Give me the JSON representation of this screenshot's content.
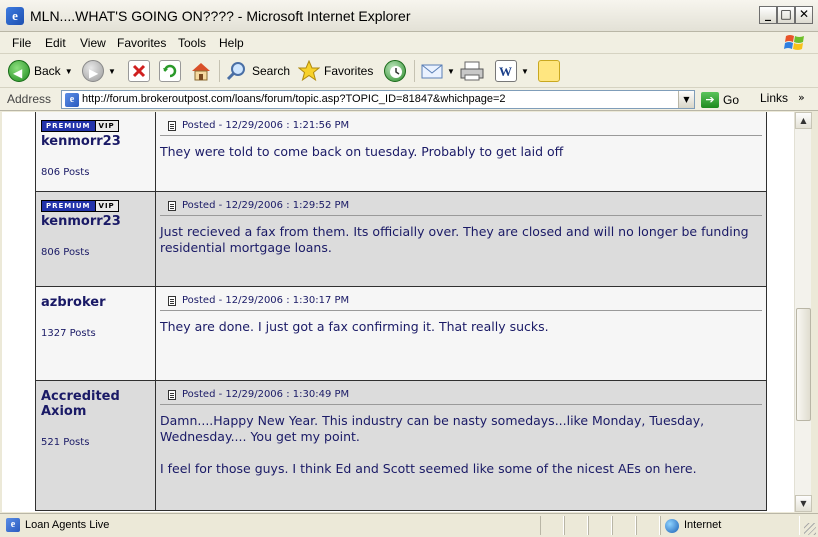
{
  "window": {
    "title": "MLN....WHAT'S GOING ON???? - Microsoft Internet Explorer",
    "minimize": "_",
    "maximize": "□",
    "close": "✕"
  },
  "menu": [
    "File",
    "Edit",
    "View",
    "Favorites",
    "Tools",
    "Help"
  ],
  "toolbar": {
    "back": "Back",
    "search": "Search",
    "favorites": "Favorites"
  },
  "address": {
    "label": "Address",
    "url": "http://forum.brokeroutpost.com/loans/forum/topic.asp?TOPIC_ID=81847&whichpage=2",
    "go": "Go",
    "links": "Links"
  },
  "posts": [
    {
      "author": "kenmorr23",
      "badges": {
        "premium": "PREMIUM",
        "vip": "VIP"
      },
      "post_count": "806 Posts",
      "posted": "Posted - 12/29/2006 :  1:21:56 PM",
      "body": [
        "They were told to come back on tuesday. Probably to get laid off"
      ]
    },
    {
      "author": "kenmorr23",
      "badges": {
        "premium": "PREMIUM",
        "vip": "VIP"
      },
      "post_count": "806 Posts",
      "posted": "Posted - 12/29/2006 :  1:29:52 PM",
      "body": [
        "Just recieved a fax from them. Its officially over. They are closed and will no longer be funding residential mortgage loans."
      ]
    },
    {
      "author": "azbroker",
      "post_count": "1327 Posts",
      "posted": "Posted - 12/29/2006 :  1:30:17 PM",
      "body": [
        "They are done. I just got a fax confirming it. That really sucks."
      ]
    },
    {
      "author": "Accredited Axiom",
      "post_count": "521 Posts",
      "posted": "Posted - 12/29/2006 :  1:30:49 PM",
      "body": [
        "Damn....Happy New Year. This industry can be nasty somedays...like Monday, Tuesday, Wednesday.... You get my point.",
        "I feel for those guys. I think Ed and Scott seemed like some of the nicest AEs on here."
      ]
    }
  ],
  "status": {
    "text": "Loan Agents Live",
    "zone": "Internet"
  }
}
